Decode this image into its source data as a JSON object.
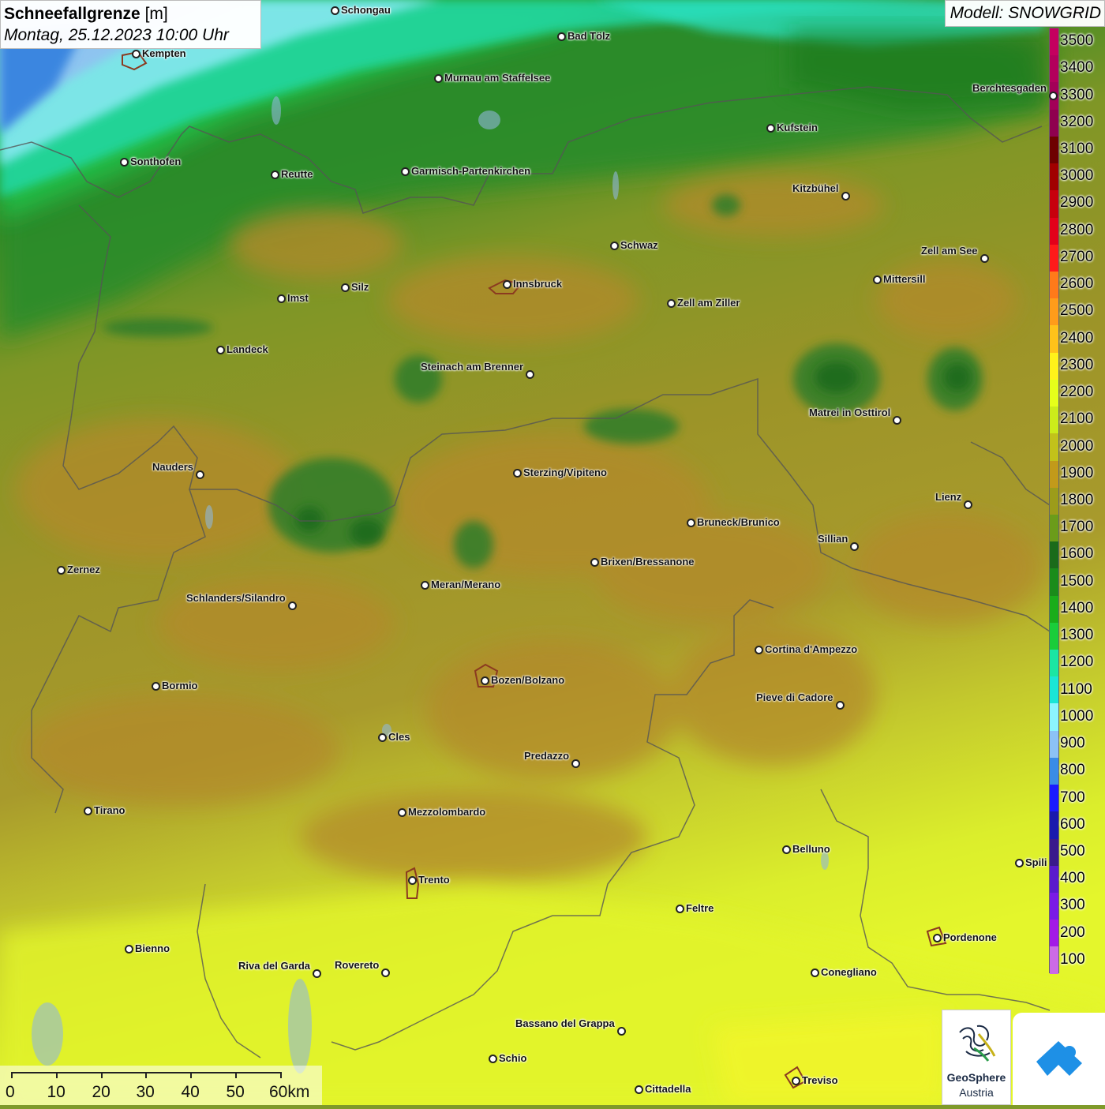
{
  "header": {
    "title": "Schneefallgrenze",
    "unit": "[m]",
    "date": "Montag, 25.12.2023 10:00 Uhr"
  },
  "model": {
    "label": "Modell: SNOWGRID"
  },
  "legend": {
    "entries": [
      {
        "label": "3500",
        "color": "#c4005f"
      },
      {
        "label": "3400",
        "color": "#b3005c"
      },
      {
        "label": "3300",
        "color": "#a30058"
      },
      {
        "label": "3200",
        "color": "#8f004f"
      },
      {
        "label": "3100",
        "color": "#6e0000"
      },
      {
        "label": "3000",
        "color": "#a10000"
      },
      {
        "label": "2900",
        "color": "#c7000d"
      },
      {
        "label": "2800",
        "color": "#e3001a"
      },
      {
        "label": "2700",
        "color": "#ff1a1a"
      },
      {
        "label": "2600",
        "color": "#ff7a1a"
      },
      {
        "label": "2500",
        "color": "#ff9c1a"
      },
      {
        "label": "2400",
        "color": "#ffc21a"
      },
      {
        "label": "2300",
        "color": "#fff21a"
      },
      {
        "label": "2200",
        "color": "#e6ff1a"
      },
      {
        "label": "2100",
        "color": "#ccec1a"
      },
      {
        "label": "2000",
        "color": "#c2c21a"
      },
      {
        "label": "1900",
        "color": "#c29a1a"
      },
      {
        "label": "1800",
        "color": "#9c9c1a"
      },
      {
        "label": "1700",
        "color": "#6b9c1a"
      },
      {
        "label": "1600",
        "color": "#1a6b1a"
      },
      {
        "label": "1500",
        "color": "#1a8c1a"
      },
      {
        "label": "1400",
        "color": "#1aad1a"
      },
      {
        "label": "1300",
        "color": "#1acd3a"
      },
      {
        "label": "1200",
        "color": "#1ae6a3"
      },
      {
        "label": "1100",
        "color": "#1ae6d6"
      },
      {
        "label": "1000",
        "color": "#8cf5ff"
      },
      {
        "label": "900",
        "color": "#8cc2f5"
      },
      {
        "label": "800",
        "color": "#3a8ce6"
      },
      {
        "label": "700",
        "color": "#1a1aff"
      },
      {
        "label": "600",
        "color": "#1a1aad"
      },
      {
        "label": "500",
        "color": "#3a1a8c"
      },
      {
        "label": "400",
        "color": "#5a1acd"
      },
      {
        "label": "300",
        "color": "#7a1ae6"
      },
      {
        "label": "200",
        "color": "#a31ae6"
      },
      {
        "label": "100",
        "color": "#cc6be6"
      }
    ]
  },
  "cities": [
    {
      "name": "Schongau",
      "side": "r"
    },
    {
      "name": "Bad Tölz",
      "side": "r"
    },
    {
      "name": "Kempten",
      "side": "r"
    },
    {
      "name": "Murnau am Staffelsee",
      "side": "r"
    },
    {
      "name": "Berchtesgaden",
      "side": "l"
    },
    {
      "name": "Kufstein",
      "side": "r"
    },
    {
      "name": "Sonthofen",
      "side": "r"
    },
    {
      "name": "Reutte",
      "side": "r"
    },
    {
      "name": "Garmisch-Partenkirchen",
      "side": "r"
    },
    {
      "name": "Kitzbühel",
      "side": "l"
    },
    {
      "name": "Schwaz",
      "side": "r"
    },
    {
      "name": "Zell am See",
      "side": "l"
    },
    {
      "name": "Innsbruck",
      "side": "r"
    },
    {
      "name": "Mittersill",
      "side": "r"
    },
    {
      "name": "Silz",
      "side": "r"
    },
    {
      "name": "Imst",
      "side": "r"
    },
    {
      "name": "Zell am Ziller",
      "side": "r"
    },
    {
      "name": "Landeck",
      "side": "r"
    },
    {
      "name": "Steinach am Brenner",
      "side": "l"
    },
    {
      "name": "Matrei in Osttirol",
      "side": "l"
    },
    {
      "name": "Nauders",
      "side": "l"
    },
    {
      "name": "Sterzing/Vipiteno",
      "side": "r"
    },
    {
      "name": "Lienz",
      "side": "l"
    },
    {
      "name": "Bruneck/Brunico",
      "side": "r"
    },
    {
      "name": "Sillian",
      "side": "l"
    },
    {
      "name": "Brixen/Bressanone",
      "side": "r"
    },
    {
      "name": "Zernez",
      "side": "r"
    },
    {
      "name": "Meran/Merano",
      "side": "r"
    },
    {
      "name": "Schlanders/Silandro",
      "side": "l"
    },
    {
      "name": "Cortina d'Ampezzo",
      "side": "r"
    },
    {
      "name": "Bozen/Bolzano",
      "side": "r"
    },
    {
      "name": "Bormio",
      "side": "r"
    },
    {
      "name": "Pieve di Cadore",
      "side": "l"
    },
    {
      "name": "Cles",
      "side": "r"
    },
    {
      "name": "Predazzo",
      "side": "l"
    },
    {
      "name": "Tirano",
      "side": "r"
    },
    {
      "name": "Mezzolombardo",
      "side": "r"
    },
    {
      "name": "Belluno",
      "side": "r"
    },
    {
      "name": "Spili",
      "side": "r"
    },
    {
      "name": "Trento",
      "side": "r"
    },
    {
      "name": "Feltre",
      "side": "r"
    },
    {
      "name": "Pordenone",
      "side": "r"
    },
    {
      "name": "Bienno",
      "side": "r"
    },
    {
      "name": "Riva del Garda",
      "side": "l"
    },
    {
      "name": "Rovereto",
      "side": "l"
    },
    {
      "name": "Conegliano",
      "side": "r"
    },
    {
      "name": "Bassano del Grappa",
      "side": "l"
    },
    {
      "name": "Schio",
      "side": "r"
    },
    {
      "name": "Treviso",
      "side": "r"
    },
    {
      "name": "Cittadella",
      "side": "r"
    }
  ],
  "scale": {
    "ticks": [
      "0",
      "10",
      "20",
      "30",
      "40",
      "50",
      "60km"
    ]
  },
  "logos": {
    "geosphere_line1": "GeoSphere",
    "geosphere_line2": "Austria"
  }
}
